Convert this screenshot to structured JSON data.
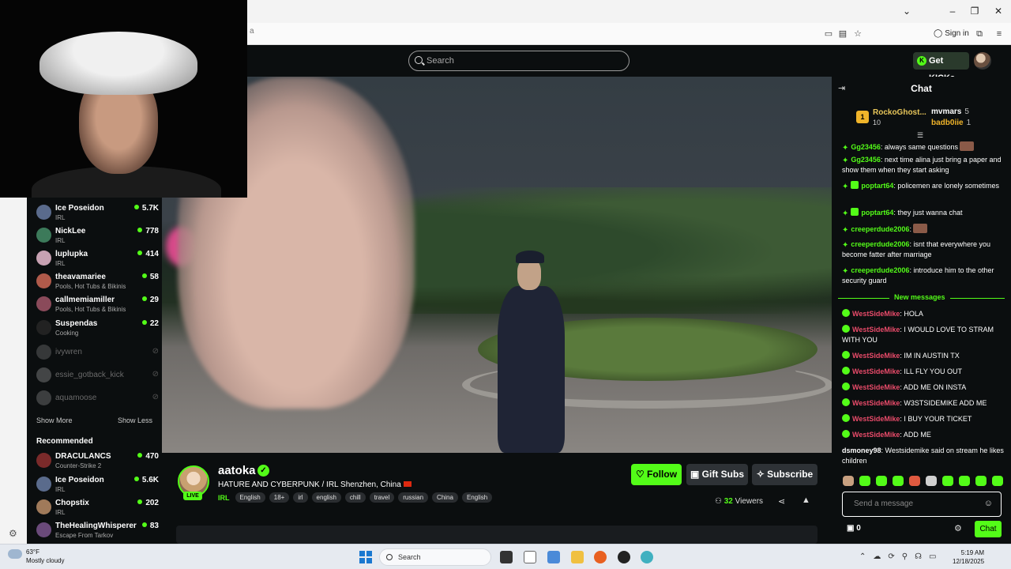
{
  "browser": {
    "url_fragment": "a",
    "signin_label": "Sign in",
    "win_minimize": "–",
    "win_restore": "❐",
    "win_close": "✕",
    "win_dropdown": "⌄"
  },
  "header": {
    "search_placeholder": "Search",
    "get_kicks_label": "Get KICKs"
  },
  "sidebar": {
    "following": [
      {
        "name": "Ice Poseidon",
        "category": "IRL",
        "viewers": "5.7K",
        "color": "#5a6b8c"
      },
      {
        "name": "NickLee",
        "category": "IRL",
        "viewers": "778",
        "color": "#3c7a5a"
      },
      {
        "name": "luplupka",
        "category": "IRL",
        "viewers": "414",
        "color": "#c7a1b2"
      },
      {
        "name": "theavamariee",
        "category": "Pools, Hot Tubs & Bikinis",
        "viewers": "58",
        "color": "#b05a4a"
      },
      {
        "name": "callmemiamiller",
        "category": "Pools, Hot Tubs & Bikinis",
        "viewers": "29",
        "color": "#8a4a5a"
      },
      {
        "name": "Suspendas",
        "category": "Cooking",
        "viewers": "22",
        "color": "#222222"
      }
    ],
    "offline": [
      {
        "name": "ivywren"
      },
      {
        "name": "essie_gotback_kick"
      },
      {
        "name": "aquamoose"
      }
    ],
    "show_more": "Show More",
    "show_less": "Show Less",
    "recommended_title": "Recommended",
    "recommended": [
      {
        "name": "DRACULANCS",
        "category": "Counter-Strike 2",
        "viewers": "470",
        "color": "#7a2a2a"
      },
      {
        "name": "Ice Poseidon",
        "category": "IRL",
        "viewers": "5.6K",
        "color": "#5a6b8c"
      },
      {
        "name": "Chopstix",
        "category": "IRL",
        "viewers": "202",
        "color": "#a07a5a"
      },
      {
        "name": "TheHealingWhisperer",
        "category": "Escape From Tarkov",
        "viewers": "83",
        "color": "#6a4a7a"
      }
    ]
  },
  "stream": {
    "channel_name": "aatoka",
    "verified_mark": "✓",
    "live_badge": "LIVE",
    "title": "HATURE AND CYBERPUNK / IRL Shenzhen, China",
    "category": "IRL",
    "tags": [
      "English",
      "18+",
      "irl",
      "english",
      "chill",
      "travel",
      "russian",
      "China",
      "English"
    ],
    "follow_label": "Follow",
    "gift_label": "Gift Subs",
    "subscribe_label": "Subscribe",
    "viewer_count": "32",
    "viewers_label": "Viewers"
  },
  "chat": {
    "title": "Chat",
    "leaderboard": {
      "first": {
        "rank": "1",
        "name": "RockoGhost...",
        "count": "10"
      },
      "second": {
        "name": "mvmars",
        "count": "5"
      },
      "third": {
        "name": "badb0iie",
        "count": "1"
      }
    },
    "messages": [
      {
        "user": "Gg23456",
        "text": ": always same questions",
        "badges": "spark",
        "color": "green"
      },
      {
        "user": "Gg23456",
        "text": ": next time alina just bring a paper and show them when they start asking",
        "badges": "spark",
        "color": "green"
      },
      {
        "user": "poptart64",
        "text": ": policemen are lonely sometimes",
        "badges": "spark-sub",
        "color": "green"
      },
      {
        "user": "poptart64",
        "text": ": they just wanna chat",
        "badges": "spark-sub",
        "color": "green"
      },
      {
        "user": "creeperdude2006",
        "text": ":",
        "badges": "spark",
        "color": "green"
      },
      {
        "user": "creeperdude2006",
        "text": ": isnt that everywhere you become fatter after marriage",
        "badges": "spark",
        "color": "green"
      },
      {
        "user": "creeperdude2006",
        "text": ": introduce him to the other security guard",
        "badges": "spark",
        "color": "green"
      }
    ],
    "new_messages_label": "New messages",
    "new_messages": [
      {
        "user": "WestSideMike",
        "text": ": HOLA"
      },
      {
        "user": "WestSideMike",
        "text": ": I WOULD LOVE TO STRAM WITH YOU"
      },
      {
        "user": "WestSideMike",
        "text": ": IM IN AUSTIN TX"
      },
      {
        "user": "WestSideMike",
        "text": ": ILL FLY YOU OUT"
      },
      {
        "user": "WestSideMike",
        "text": ": ADD ME ON INSTA"
      },
      {
        "user": "WestSideMike",
        "text": ": W3STSIDEMIKE ADD ME"
      },
      {
        "user": "WestSideMike",
        "text": ": I BUY YOUR TICKET"
      },
      {
        "user": "WestSideMike",
        "text": ": ADD ME"
      }
    ],
    "last_message": {
      "user": "dsmoney98",
      "text": ": Westsidemike said on stream he likes children"
    },
    "input_placeholder": "Send a message",
    "wallet_count": "0",
    "send_label": "Chat"
  },
  "taskbar": {
    "temperature": "63°F",
    "weather": "Mostly cloudy",
    "search_label": "Search",
    "time": "5:19 AM",
    "date": "12/18/2025"
  },
  "colors": {
    "accent": "#53fc18",
    "background": "#0b0e0f",
    "spammer": "#e94b6a"
  }
}
